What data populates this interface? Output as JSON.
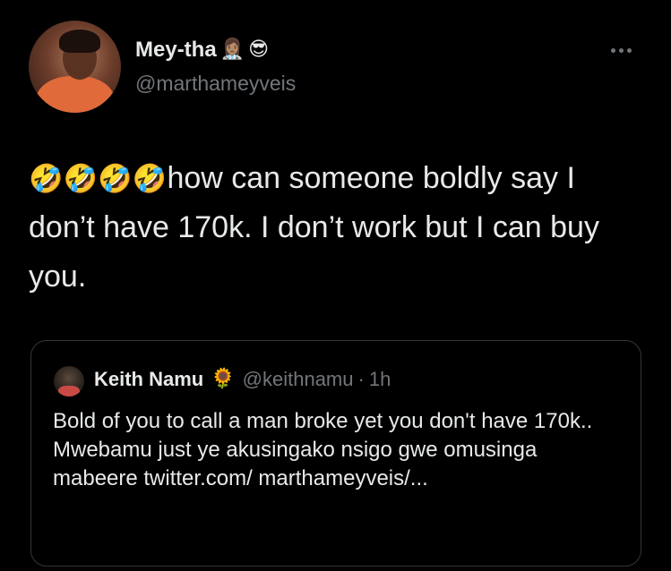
{
  "author": {
    "display_name": "Mey-tha",
    "name_emojis": [
      "👩🏽‍⚕️",
      "😎"
    ],
    "handle": "@marthameyveis"
  },
  "tweet": {
    "emojis": [
      "🤣",
      "🤣",
      "🤣",
      "🤣"
    ],
    "text": "how can someone boldly say I don’t have 170k. I don’t work but I can buy you."
  },
  "quoted_tweet": {
    "display_name": "Keith Namu",
    "name_emoji": "🌻",
    "handle": "@keithnamu",
    "separator": "·",
    "time": "1h",
    "text": "Bold of you to call a man broke yet you don't have 170k.. Mwebamu just ye akusingako nsigo gwe omusinga mabeere twitter.com/ marthameyveis/..."
  },
  "icons": {
    "more": "more-horizontal-icon"
  },
  "colors": {
    "background": "#000000",
    "primary_text": "#e7e9ea",
    "secondary_text": "#71767b",
    "border": "#333639"
  }
}
